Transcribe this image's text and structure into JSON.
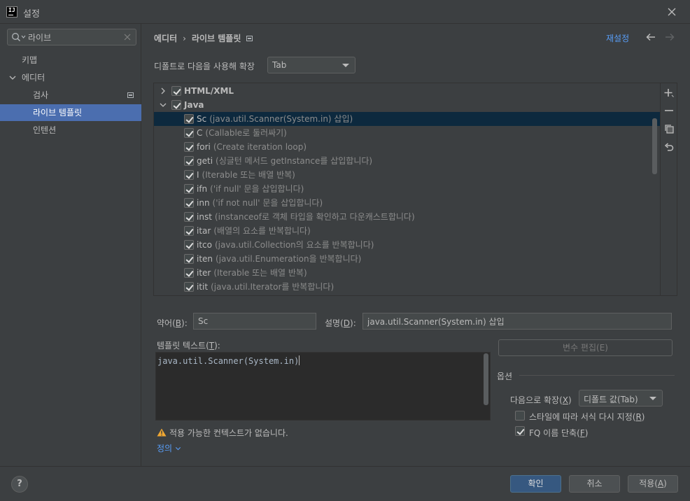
{
  "window": {
    "title": "설정",
    "app_icon_text": "IJ"
  },
  "sidebar": {
    "search_value": "라이브",
    "items": [
      {
        "label": "키맵"
      },
      {
        "label": "에디터"
      },
      {
        "label": "검사"
      },
      {
        "label": "라이브 템플릿"
      },
      {
        "label": "인텐션"
      }
    ]
  },
  "header": {
    "breadcrumb": [
      "에디터",
      "라이브 템플릿"
    ],
    "breadcrumb_sep": "›",
    "reset_label": "재설정"
  },
  "expand_default": {
    "label": "디폴트로 다음을 사용해 확장",
    "value": "Tab"
  },
  "templates": {
    "groups": [
      {
        "name": "HTML/XML",
        "checked": true,
        "expanded": false
      },
      {
        "name": "Java",
        "checked": true,
        "expanded": true
      }
    ],
    "items": [
      {
        "abbr": "Sc",
        "desc": "(java.util.Scanner(System.in) 삽입)",
        "checked": true
      },
      {
        "abbr": "C",
        "desc": "(Callable로 둘러싸기)",
        "checked": true
      },
      {
        "abbr": "fori",
        "desc": "(Create iteration loop)",
        "checked": true
      },
      {
        "abbr": "geti",
        "desc": "(싱글턴 메서드 getInstance를 삽입합니다)",
        "checked": true
      },
      {
        "abbr": "I",
        "desc": "(Iterable 또는 배열 반복)",
        "checked": true
      },
      {
        "abbr": "ifn",
        "desc": "('if null' 문을 삽입합니다)",
        "checked": true
      },
      {
        "abbr": "inn",
        "desc": "('if not null' 문을 삽입합니다)",
        "checked": true
      },
      {
        "abbr": "inst",
        "desc": "(instanceof로 객체 타입을 확인하고 다운캐스트합니다)",
        "checked": true
      },
      {
        "abbr": "itar",
        "desc": "(배열의 요소를 반복합니다)",
        "checked": true
      },
      {
        "abbr": "itco",
        "desc": "(java.util.Collection의 요소를 반복합니다)",
        "checked": true
      },
      {
        "abbr": "iten",
        "desc": "(java.util.Enumeration을 반복합니다)",
        "checked": true
      },
      {
        "abbr": "iter",
        "desc": "(Iterable 또는 배열 반복)",
        "checked": true
      },
      {
        "abbr": "itit",
        "desc": "(java.util.Iterator를 반복합니다)",
        "checked": true
      }
    ],
    "toolbar": [
      "plus-icon",
      "minus-icon",
      "copy-icon",
      "restore-icon"
    ]
  },
  "editor": {
    "abbr_label": "약어",
    "abbr_mnemonic": "B",
    "abbr_value": "Sc",
    "desc_label": "설명",
    "desc_mnemonic": "D",
    "desc_value": "java.util.Scanner(System.in) 삽입",
    "text_label": "템플릿 텍스트",
    "text_mnemonic": "T",
    "text_value": "java.util.Scanner(System.in)",
    "warning": "적용 가능한 컨텍스트가 없습니다.",
    "define_link": "정의"
  },
  "options": {
    "edit_vars_label": "변수 편집(E)",
    "title": "옵션",
    "expand_with_label": "다음으로 확장",
    "expand_with_mnemonic": "X",
    "expand_with_value": "디폴트 값(Tab)",
    "reformat_label": "스타일에 따라 서식 다시 지정",
    "reformat_mnemonic": "R",
    "reformat_checked": false,
    "fq_label": "FQ 이름 단축",
    "fq_mnemonic": "F",
    "fq_checked": true
  },
  "footer": {
    "help": "?",
    "ok": "확인",
    "cancel": "취소",
    "apply_label": "적용",
    "apply_mnemonic": "A"
  },
  "colors": {
    "background": "#3c3f41",
    "selection": "#4b6eaf",
    "row_selection": "#0d293e",
    "link": "#589df6",
    "primary_button": "#365880",
    "warning": "#f0a732"
  }
}
